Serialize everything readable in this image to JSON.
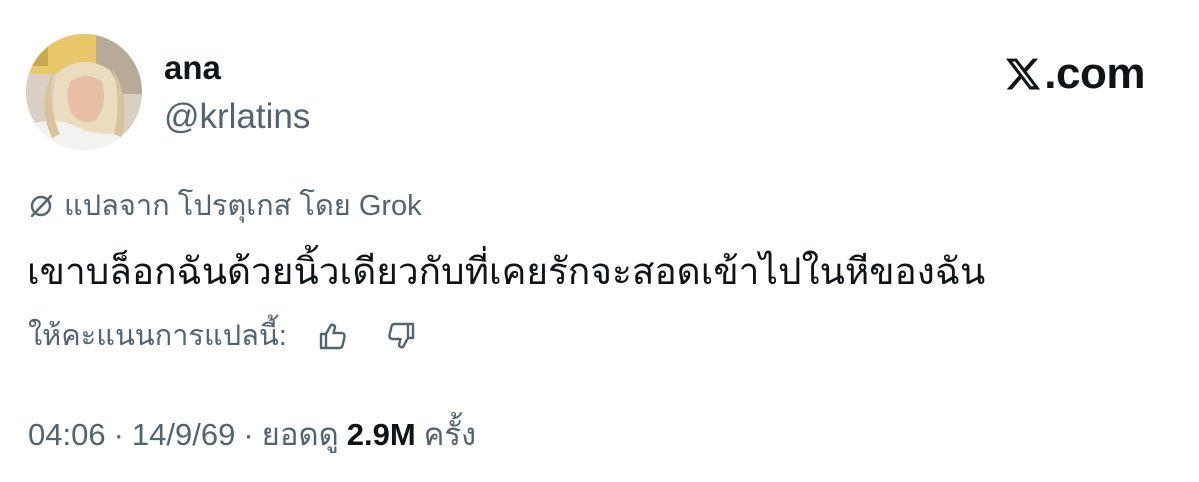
{
  "user": {
    "display_name": "ana",
    "handle": "@krlatins"
  },
  "brand": {
    "text": ".com",
    "logo_icon": "x-logo-icon"
  },
  "translation": {
    "icon": "translate-globe-icon",
    "label": "แปลจาก โปรตุเกส โดย Grok"
  },
  "tweet": {
    "text": "เขาบล็อกฉันด้วยนิ้วเดียวกับที่เคยรักจะสอดเข้าไปในหีของฉัน"
  },
  "rating": {
    "label": "ให้คะแนนการแปลนี้:",
    "thumbs_up_icon": "thumbs-up-icon",
    "thumbs_down_icon": "thumbs-down-icon"
  },
  "meta": {
    "time": "04:06",
    "separator": "·",
    "date": "14/9/69",
    "views_label": "ยอดดู",
    "views_count": "2.9M",
    "views_unit": "ครั้ง"
  },
  "colors": {
    "text_primary": "#0f1419",
    "text_secondary": "#536471",
    "background": "#ffffff"
  }
}
